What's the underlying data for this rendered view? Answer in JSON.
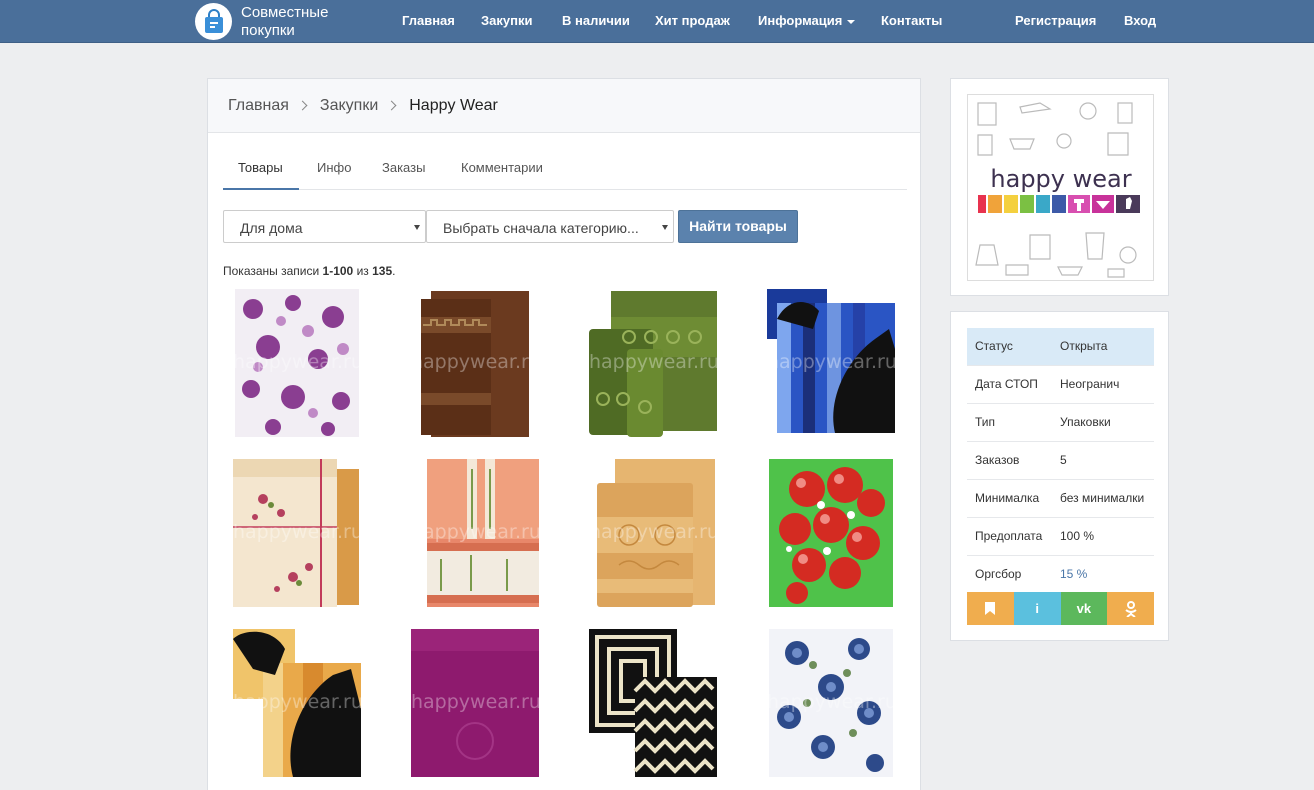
{
  "navbar": {
    "brand": "Совместные покупки",
    "links": [
      "Главная",
      "Закупки",
      "В наличии",
      "Хит продаж",
      "Информация",
      "Контакты"
    ],
    "register": "Регистрация",
    "login": "Вход"
  },
  "breadcrumb": {
    "home": "Главная",
    "purchases": "Закупки",
    "current": "Happy Wear"
  },
  "tabs": [
    "Товары",
    "Инфо",
    "Заказы",
    "Комментарии"
  ],
  "filters": {
    "category": "Для дома",
    "subcategory": "Выбрать сначала категорию...",
    "find_button": "Найти товары"
  },
  "records": {
    "prefix": "Показаны записи ",
    "range": "1-100",
    "middle": " из ",
    "total": "135",
    "suffix": "."
  },
  "products": [
    {
      "watermark": "happywear.ru",
      "style": "floral-purple"
    },
    {
      "watermark": "happywear.ru",
      "style": "brown-greek"
    },
    {
      "watermark": "happywear.ru",
      "style": "green-swirl"
    },
    {
      "watermark": "happywear.ru",
      "style": "blue-horse"
    },
    {
      "watermark": "happywear.ru",
      "style": "beige-floral"
    },
    {
      "watermark": "happywear.ru",
      "style": "peach-bamboo"
    },
    {
      "watermark": "happywear.ru",
      "style": "gold-bamboo"
    },
    {
      "watermark": "",
      "style": "green-apples"
    },
    {
      "watermark": "happywear.ru",
      "style": "orange-horse"
    },
    {
      "watermark": "happywear.ru",
      "style": "purple-plain"
    },
    {
      "watermark": "",
      "style": "black-geometric"
    },
    {
      "watermark": "happywear.ru",
      "style": "blue-floral"
    }
  ],
  "logo": {
    "text": "happy wear"
  },
  "info": {
    "rows": [
      {
        "label": "Статус",
        "value": "Открыта"
      },
      {
        "label": "Дата СТОП",
        "value": "Неогранич"
      },
      {
        "label": "Тип",
        "value": "Упаковки"
      },
      {
        "label": "Заказов",
        "value": "5"
      },
      {
        "label": "Минималка",
        "value": "без минималки"
      },
      {
        "label": "Предоплата",
        "value": "100 %"
      },
      {
        "label": "Оргсбор",
        "value": "15 %"
      }
    ]
  },
  "share": [
    {
      "icon": "bookmark-icon",
      "glyph": "",
      "color": "#f0ad4e"
    },
    {
      "icon": "info-icon",
      "glyph": "i",
      "color": "#5bc0de"
    },
    {
      "icon": "vk-icon",
      "glyph": "vk",
      "color": "#5cb85c"
    },
    {
      "icon": "odnoklassniki-icon",
      "glyph": "",
      "color": "#f0ad4e"
    }
  ],
  "colors": {
    "navbar": "#4a6f9a",
    "accent": "#4a76a8",
    "link_value": "#4a76a8"
  }
}
